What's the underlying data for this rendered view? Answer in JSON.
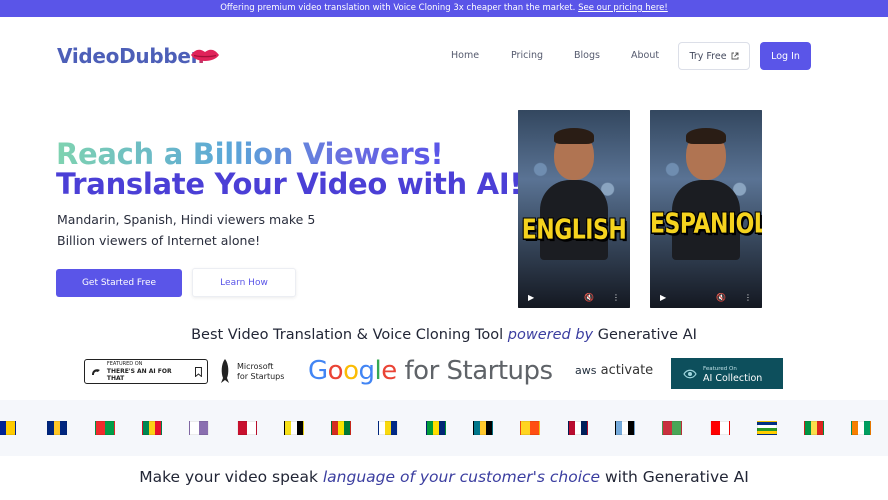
{
  "banner": {
    "text": "Offering premium video translation with Voice Cloning 3x cheaper than the market. ",
    "link": "See our pricing here!"
  },
  "nav": {
    "logo_part1": "VideoDubber",
    "logo_part2": ".",
    "links": [
      "Home",
      "Pricing",
      "Blogs",
      "About"
    ],
    "try_free": "Try Free",
    "login": "Log In"
  },
  "hero": {
    "headline_1": "Reach a Billion Viewers!",
    "headline_2": "Translate Your Video with AI!",
    "subtext": "Mandarin, Spanish, Hindi viewers make 5 Billion viewers of Internet alone!",
    "cta_primary": "Get Started Free",
    "cta_secondary": "Learn How"
  },
  "videos": [
    {
      "label": "ENGLISH"
    },
    {
      "label": "ESPANIOL"
    }
  ],
  "tagline": {
    "before": "Best Video Translation & Voice Cloning Tool ",
    "emph": "powered by",
    "after": " Generative AI"
  },
  "partner_logos": {
    "aiforthat_small": "FEATURED ON",
    "aiforthat": "THERE'S AN AI FOR THAT",
    "microsoft_1": "Microsoft",
    "microsoft_2": "for Startups",
    "google_letters": [
      "G",
      "o",
      "o",
      "g",
      "l",
      "e"
    ],
    "google_suffix": " for Startups",
    "aws": "aws",
    "aws_suffix": " activate",
    "aicollection_small": "Featured On",
    "aicollection": "AI Collection"
  },
  "flags": [
    {
      "name": "bosnia",
      "colors": [
        "#002395",
        "#fecb00"
      ]
    },
    {
      "name": "barbados",
      "colors": [
        "#00267f",
        "#ffc726",
        "#00267f"
      ]
    },
    {
      "name": "burkina-faso",
      "colors": [
        "#ef2b2d",
        "#009e49"
      ]
    },
    {
      "name": "benin",
      "colors": [
        "#008751",
        "#fcd116",
        "#e8112d"
      ]
    },
    {
      "name": "bermuda-crest",
      "colors": [
        "#ffffff",
        "#8a6fb0"
      ]
    },
    {
      "name": "bermuda",
      "colors": [
        "#c8102e",
        "#ffffff"
      ]
    },
    {
      "name": "brunei",
      "colors": [
        "#f7e017",
        "#ffffff",
        "#000000"
      ]
    },
    {
      "name": "bolivia",
      "colors": [
        "#d52b1e",
        "#f9e300",
        "#007934"
      ]
    },
    {
      "name": "bonaire",
      "colors": [
        "#ffffff",
        "#f9d90f",
        "#012a87"
      ]
    },
    {
      "name": "brazil",
      "colors": [
        "#009b3a",
        "#fedf00",
        "#002776"
      ]
    },
    {
      "name": "bahamas",
      "colors": [
        "#00778b",
        "#ffc72c",
        "#000000"
      ]
    },
    {
      "name": "bhutan",
      "colors": [
        "#ffd520",
        "#ff4e12"
      ]
    },
    {
      "name": "norway",
      "colors": [
        "#ba0c2f",
        "#ffffff",
        "#00205b"
      ]
    },
    {
      "name": "botswana",
      "colors": [
        "#75aadb",
        "#ffffff",
        "#000000"
      ]
    },
    {
      "name": "belarus",
      "colors": [
        "#c8313e",
        "#4aa657"
      ]
    },
    {
      "name": "canada",
      "colors": [
        "#ff0000",
        "#ffffff"
      ]
    },
    {
      "name": "central-african-republic",
      "colors": [
        "#003082",
        "#ffffff",
        "#289728",
        "#ffce00"
      ]
    },
    {
      "name": "congo",
      "colors": [
        "#009543",
        "#fbde4a",
        "#dc241f"
      ]
    },
    {
      "name": "ivory-coast",
      "colors": [
        "#f77f00",
        "#ffffff",
        "#009e60"
      ]
    }
  ],
  "bottom_line": {
    "before": "Make your video speak ",
    "emph": "language of your customer's choice",
    "after": " with Generative AI"
  },
  "colors": {
    "brand": "#5a55e8",
    "headline_dark": "#4b3fd6",
    "logo_blue": "#4d5fb8",
    "logo_red": "#c03a6b"
  }
}
